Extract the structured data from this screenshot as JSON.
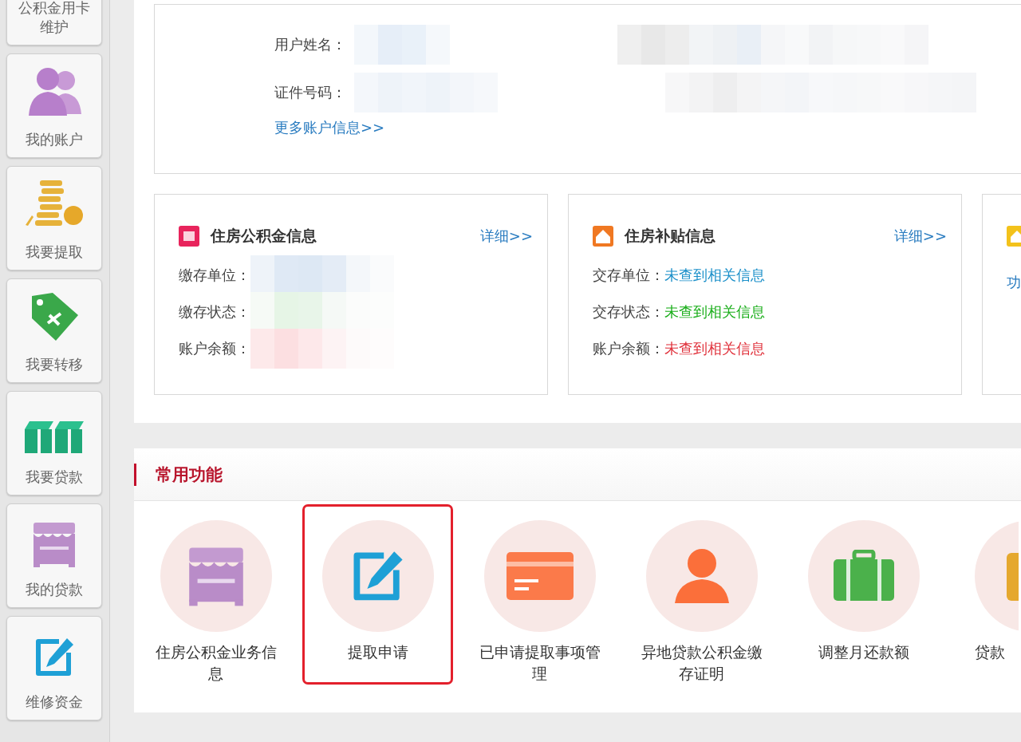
{
  "sidebar": {
    "items": [
      {
        "label": "公积金用卡维护"
      },
      {
        "label": "我的账户"
      },
      {
        "label": "我要提取"
      },
      {
        "label": "我要转移"
      },
      {
        "label": "我要贷款"
      },
      {
        "label": "我的贷款"
      },
      {
        "label": "维修资金"
      }
    ]
  },
  "account": {
    "fields": [
      {
        "label": "用户姓名："
      },
      {
        "label": "证件号码："
      }
    ],
    "more_link": "更多账户信息>>"
  },
  "info_cards": [
    {
      "title": "住房公积金信息",
      "detail_link": "详细>>",
      "rows": [
        {
          "label": "缴存单位："
        },
        {
          "label": "缴存状态："
        },
        {
          "label": "账户余额："
        }
      ]
    },
    {
      "title": "住房补贴信息",
      "detail_link": "详细>>",
      "rows": [
        {
          "label": "交存单位：",
          "value": "未查到相关信息",
          "color": "#1a8fc9"
        },
        {
          "label": "交存状态：",
          "value": "未查到相关信息",
          "color": "#1aae1a"
        },
        {
          "label": "账户余额：",
          "value": "未查到相关信息",
          "color": "#e0303a"
        }
      ]
    },
    {
      "note": "功"
    }
  ],
  "functions": {
    "title": "常用功能",
    "items": [
      {
        "label": "住房公积金业务信息",
        "selected": false
      },
      {
        "label": "提取申请",
        "selected": true
      },
      {
        "label": "已申请提取事项管理",
        "selected": false
      },
      {
        "label": "异地贷款公积金缴存证明",
        "selected": false
      },
      {
        "label": "调整月还款额",
        "selected": false
      },
      {
        "label": "贷款",
        "selected": false
      }
    ]
  }
}
